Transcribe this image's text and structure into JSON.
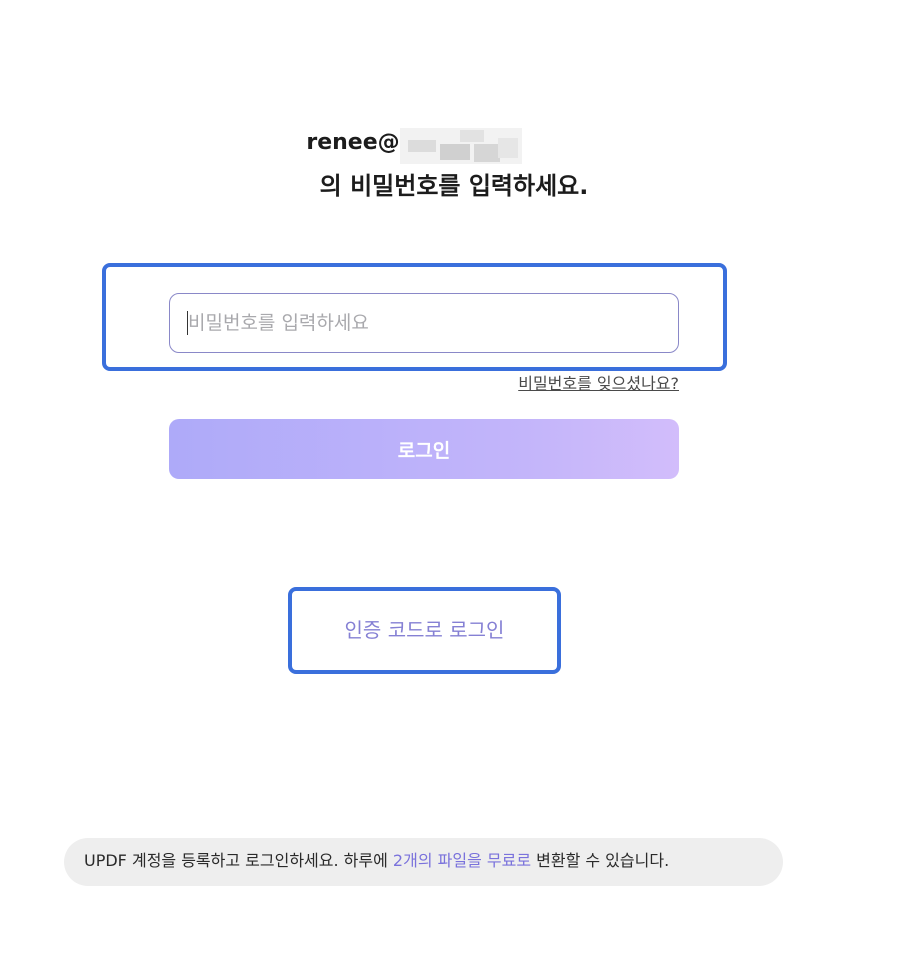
{
  "account": {
    "email_visible_prefix": "renee@"
  },
  "heading": "의 비밀번호를 입력하세요.",
  "password": {
    "placeholder": "비밀번호를 입력하세요",
    "value": ""
  },
  "forgot_password_link": "비밀번호를 잊으셨나요?",
  "login_button": "로그인",
  "code_login_link": "인증 코드로 로그인",
  "footer": {
    "prefix": "UPDF 계정을 등록하고 로그인하세요. 하루에 ",
    "highlight": "2개의 파일을 무료로",
    "suffix": " 변환할 수 있습니다."
  },
  "colors": {
    "highlight_border": "#3a6fdc",
    "accent_text": "#7a72dc",
    "button_gradient_start": "#aeaaf9",
    "button_gradient_end": "#d2bdfb"
  }
}
